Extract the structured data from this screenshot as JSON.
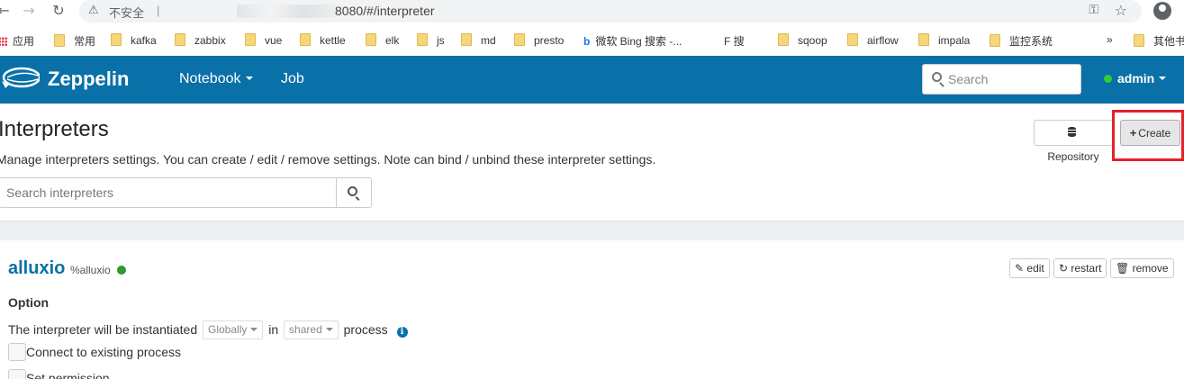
{
  "browser": {
    "security_label": "不安全",
    "url": "8080/#/interpreter",
    "bookmarks": [
      "应用",
      "常用",
      "kafka",
      "zabbix",
      "vue",
      "kettle",
      "elk",
      "js",
      "md",
      "presto",
      "微软 Bing 搜索 -...",
      "F 搜",
      "sqoop",
      "airflow",
      "impala",
      "监控系统",
      "其他书"
    ],
    "overflow": "»"
  },
  "navbar": {
    "brand": "Zeppelin",
    "notebook": "Notebook",
    "job": "Job",
    "search_placeholder": "Search",
    "user": "admin",
    "user_status_color": "#33cc33",
    "bg_color": "#0a70a8"
  },
  "header": {
    "title": "Interpreters",
    "description": "Manage interpreters settings. You can create / edit / remove settings. Note can bind / unbind these interpreter settings.",
    "repository_label": "Repository",
    "create_label": "Create",
    "search_placeholder": "Search interpreters",
    "highlight_color": "#e8202a"
  },
  "interpreter": {
    "name": "alluxio",
    "tag": "%alluxio",
    "status_color": "#2c9a2c",
    "edit_label": "edit",
    "restart_label": "restart",
    "remove_label": "remove",
    "option_label": "Option",
    "instantiated_text": "The interpreter will be instantiated",
    "scope_value": "Globally",
    "in_text": "in",
    "mode_value": "shared",
    "process_text": "process",
    "connect_label": "Connect to existing process",
    "permission_label": "Set permission"
  }
}
